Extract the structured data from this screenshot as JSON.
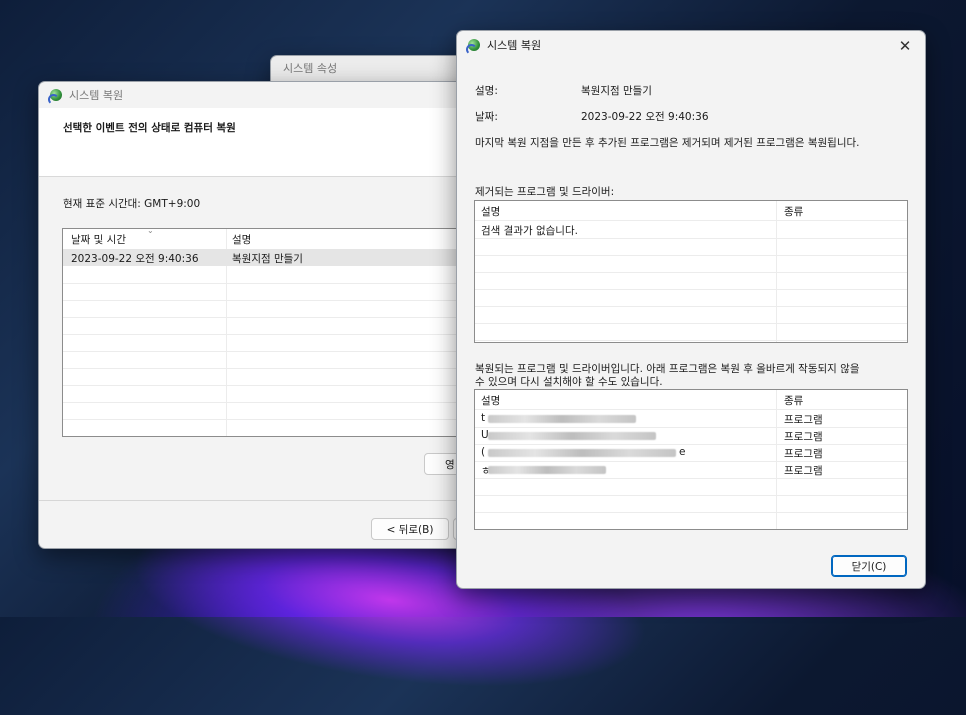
{
  "props_window": {
    "title": "시스템 속성"
  },
  "wizard": {
    "title": "시스템 복원",
    "heading": "선택한 이벤트 전의 상태로 컴퓨터 복원",
    "timezone": "현재 표준 시간대: GMT+9:00",
    "columns": [
      "날짜 및 시간",
      "설명"
    ],
    "rows": [
      {
        "date": "2023-09-22 오전 9:40:36",
        "desc": "복원지점 만들기"
      }
    ],
    "affected_button": "영",
    "back_button": "< 뒤로(B)"
  },
  "dialog": {
    "title": "시스템 복원",
    "close_glyph": "✕",
    "desc_label": "설명:",
    "desc_value": "복원지점 만들기",
    "date_label": "날짜:",
    "date_value": "2023-09-22 오전 9:40:36",
    "note": "마지막 복원 지점을 만든 후 추가된 프로그램은 제거되며 제거된 프로그램은 복원됩니다.",
    "removed_title": "제거되는 프로그램 및 드라이버:",
    "removed_columns": [
      "설명",
      "종류"
    ],
    "removed_empty": "검색 결과가 없습니다.",
    "restored_title_line1": "복원되는 프로그램 및 드라이버입니다. 아래 프로그램은 복원 후 올바르게 작동되지 않을",
    "restored_title_line2": "수 있으며 다시 설치해야 할 수도 있습니다.",
    "restored_columns": [
      "설명",
      "종류"
    ],
    "restored_rows": [
      {
        "prefix": "t",
        "suffix": "",
        "type": "프로그램"
      },
      {
        "prefix": "U",
        "suffix": "",
        "type": "프로그램"
      },
      {
        "prefix": "(",
        "suffix": "e",
        "type": "프로그램"
      },
      {
        "prefix": "ㅎ",
        "suffix": "",
        "type": "프로그램"
      }
    ],
    "close_button": "닫기(C)"
  }
}
